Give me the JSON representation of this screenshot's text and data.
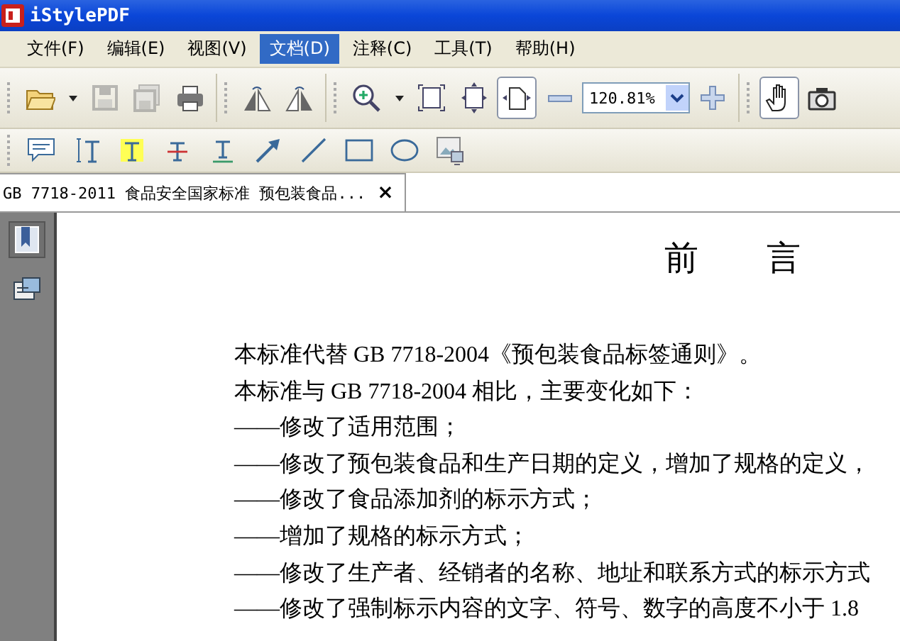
{
  "window": {
    "title": "iStylePDF"
  },
  "menu": [
    {
      "label": "文件(F)",
      "selected": false
    },
    {
      "label": "编辑(E)",
      "selected": false
    },
    {
      "label": "视图(V)",
      "selected": false
    },
    {
      "label": "文档(D)",
      "selected": true
    },
    {
      "label": "注释(C)",
      "selected": false
    },
    {
      "label": "工具(T)",
      "selected": false
    },
    {
      "label": "帮助(H)",
      "selected": false
    }
  ],
  "toolbar": [
    {
      "kind": "open",
      "selected": false,
      "disabled": false
    },
    {
      "kind": "caret",
      "selected": false,
      "disabled": false
    },
    {
      "kind": "save",
      "selected": false,
      "disabled": true
    },
    {
      "kind": "save-all",
      "selected": false,
      "disabled": true
    },
    {
      "kind": "print",
      "selected": false,
      "disabled": false
    },
    {
      "kind": "sep"
    },
    {
      "kind": "flip-left",
      "selected": false,
      "disabled": false
    },
    {
      "kind": "flip-right",
      "selected": false,
      "disabled": false
    },
    {
      "kind": "sep"
    },
    {
      "kind": "zoom-in",
      "selected": false,
      "disabled": false
    },
    {
      "kind": "caret",
      "selected": false,
      "disabled": false
    },
    {
      "kind": "fit-page",
      "selected": false,
      "disabled": false
    },
    {
      "kind": "fit-height",
      "selected": false,
      "disabled": false
    },
    {
      "kind": "fit-width",
      "selected": true,
      "disabled": false
    },
    {
      "kind": "minus",
      "selected": false,
      "disabled": false
    },
    {
      "kind": "zoom-field",
      "value": "120.81%"
    },
    {
      "kind": "plus",
      "selected": false,
      "disabled": false
    },
    {
      "kind": "sep"
    },
    {
      "kind": "hand",
      "selected": true,
      "disabled": false
    },
    {
      "kind": "camera",
      "selected": false,
      "disabled": false
    }
  ],
  "annotation_toolbar": [
    {
      "kind": "note",
      "selected": false
    },
    {
      "kind": "text-select",
      "selected": false
    },
    {
      "kind": "highlight",
      "selected": false
    },
    {
      "kind": "strike",
      "selected": false
    },
    {
      "kind": "underline",
      "selected": false
    },
    {
      "kind": "arrow",
      "selected": false
    },
    {
      "kind": "line",
      "selected": false
    },
    {
      "kind": "rect",
      "selected": false
    },
    {
      "kind": "ellipse",
      "selected": false
    },
    {
      "kind": "image",
      "selected": false
    }
  ],
  "tabs": [
    {
      "label": "GB 7718-2011 食品安全国家标准 预包装食品...",
      "close": "×",
      "selected": true
    }
  ],
  "sidebar": [
    {
      "kind": "bookmark",
      "selected": true
    },
    {
      "kind": "attachment",
      "selected": false
    }
  ],
  "document": {
    "heading": "前　　言",
    "lines": [
      "本标准代替 GB 7718-2004《预包装食品标签通则》。",
      "本标准与 GB 7718-2004 相比，主要变化如下：",
      "——修改了适用范围；",
      "——修改了预包装食品和生产日期的定义，增加了规格的定义，",
      "——修改了食品添加剂的标示方式；",
      "——增加了规格的标示方式；",
      "——修改了生产者、经销者的名称、地址和联系方式的标示方式",
      "——修改了强制标示内容的文字、符号、数字的高度不小于 1.8"
    ]
  }
}
